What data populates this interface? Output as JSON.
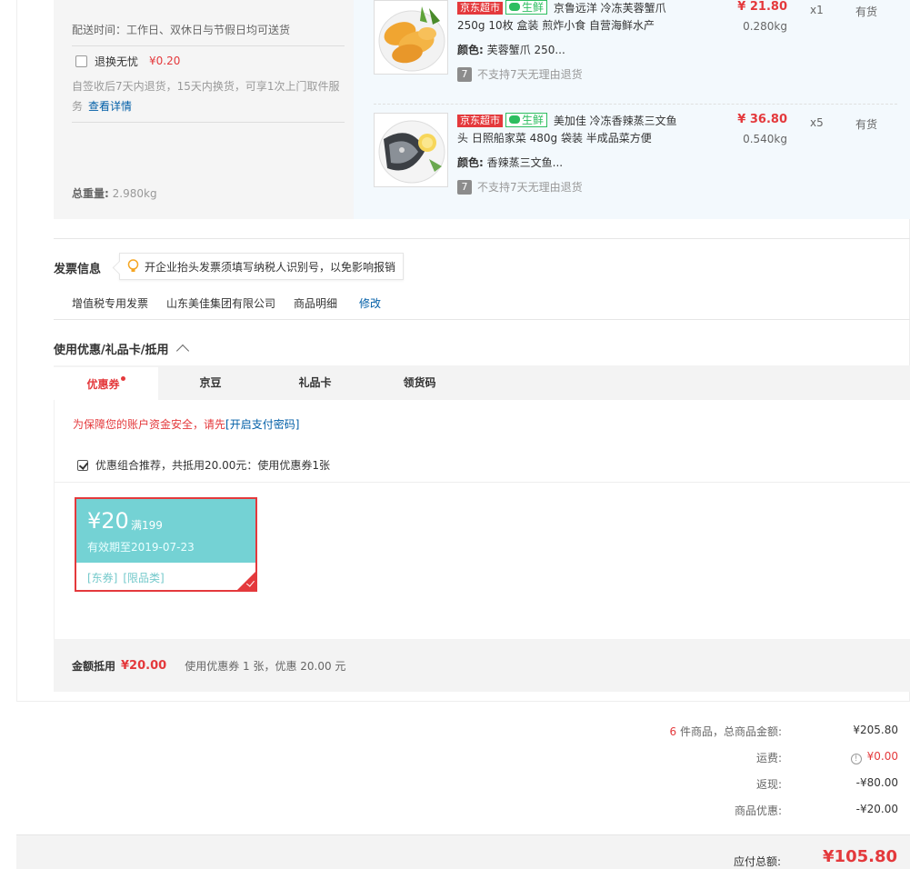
{
  "shipping": {
    "delivery_time": "配送时间：工作日、双休日与节假日均可送货",
    "return_label": "退换无忧",
    "return_price": "¥0.20",
    "return_desc": "自签收后7天内退货，15天内换货，可享1次上门取件服务",
    "view_details": "查看详情",
    "total_weight_label": "总重量:",
    "total_weight_value": "2.980kg"
  },
  "products": [
    {
      "tag_jd": "京东超市",
      "tag_fresh": "生鲜",
      "title": "京鲁远洋 冷冻芙蓉蟹爪 250g 10枚 盒装 煎炸小食 自营海鲜水产",
      "color_label": "颜色:",
      "color_value": "芙蓉蟹爪 250...",
      "no_return_icon": "7",
      "no_return": "不支持7天无理由退货",
      "price": "¥ 21.80",
      "weight": "0.280kg",
      "qty": "x1",
      "stock": "有货"
    },
    {
      "tag_jd": "京东超市",
      "tag_fresh": "生鲜",
      "title": "美加佳 冷冻香辣蒸三文鱼头 日照船家菜 480g 袋装 半成品菜方便",
      "color_label": "颜色:",
      "color_value": "香辣蒸三文鱼...",
      "no_return_icon": "7",
      "no_return": "不支持7天无理由退货",
      "price": "¥ 36.80",
      "weight": "0.540kg",
      "qty": "x5",
      "stock": "有货"
    }
  ],
  "invoice": {
    "title": "发票信息",
    "tip": "开企业抬头发票须填写纳税人识别号，以免影响报销",
    "type": "增值税专用发票",
    "company": "山东美佳集团有限公司",
    "detail": "商品明细",
    "modify": "修改"
  },
  "discount": {
    "title": "使用优惠/礼品卡/抵用",
    "tabs": [
      "优惠券",
      "京豆",
      "礼品卡",
      "领货码"
    ],
    "security_text": "为保障您的账户资金安全，请先",
    "security_link": "[开启支付密码]",
    "combo_text": "优惠组合推荐，共抵用20.00元：使用优惠券1张",
    "coupon": {
      "amount": "¥20",
      "condition": "满199",
      "valid": "有效期至2019-07-23",
      "tag1": "[东券]",
      "tag2": "[限品类]"
    },
    "sum_label": "金额抵用",
    "sum_amount": "¥20.00",
    "sum_desc": "使用优惠券 1 张，优惠 20.00 元"
  },
  "totals": {
    "count": "6",
    "items_label": " 件商品，总商品金额:",
    "items_value": "¥205.80",
    "freight_label": "运费:",
    "freight_info_icon": "!",
    "freight_value": "¥0.00",
    "cashback_label": "返现:",
    "cashback_value": "-¥80.00",
    "goods_discount_label": "商品优惠:",
    "goods_discount_value": "-¥20.00",
    "pay_label": "应付总额:",
    "pay_value": "¥105.80"
  },
  "colors": {
    "accent_red": "#e4393c",
    "link_blue": "#005ea7",
    "coupon_teal": "#74d2d4",
    "fresh_green": "#2dbe60"
  }
}
